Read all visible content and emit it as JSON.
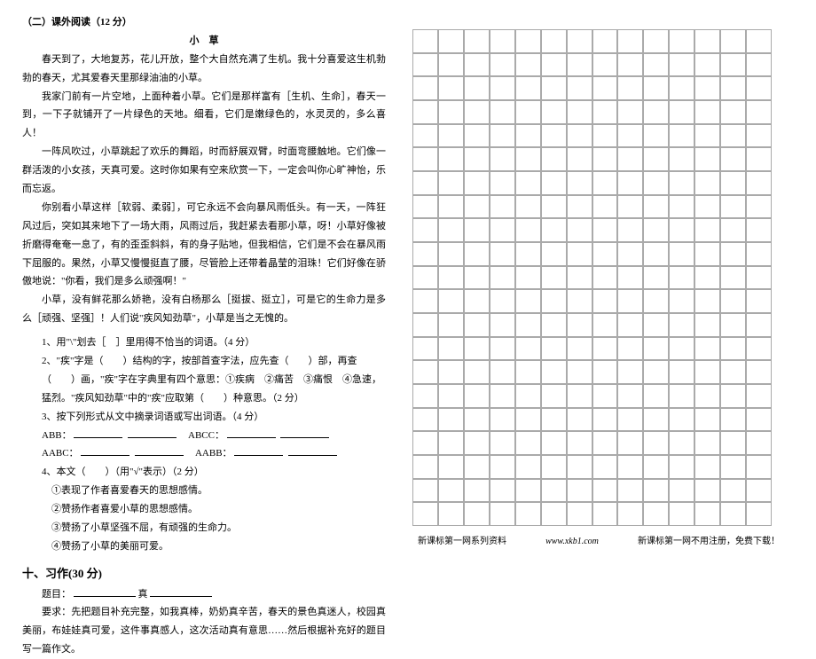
{
  "left": {
    "head1": "（二）课外阅读（12 分）",
    "title": "小　草",
    "p1": "春天到了，大地复苏，花儿开放，整个大自然充满了生机。我十分喜爱这生机勃勃的春天，尤其爱春天里那绿油油的小草。",
    "p2": "我家门前有一片空地，上面种着小草。它们是那样富有［生机、生命］，春天一到，一下子就铺开了一片绿色的天地。细看，它们是嫩绿色的，水灵灵的，多么喜人！",
    "p3": "一阵风吹过，小草跳起了欢乐的舞蹈，时而舒展双臂，时面弯腰触地。它们像一群活泼的小女孩，天真可爱。这时你如果有空来欣赏一下，一定会叫你心旷神怡，乐而忘返。",
    "p4": "你别看小草这样［软弱、柔弱］，可它永远不会向暴风雨低头。有一天，一阵狂风过后，突如其来地下了一场大雨，风雨过后，我赶紧去看那小草，呀！小草好像被折磨得奄奄一息了，有的歪歪斜斜，有的身子贴地，但我相信，它们是不会在暴风雨下屈服的。果然，小草又慢慢挺直了腰，尽管脸上还带着晶莹的泪珠！它们好像在骄傲地说：\"你看，我们是多么顽强啊！\"",
    "p5": "小草，没有鲜花那么娇艳，没有白杨那么［挺拔、挺立］，可是它的生命力是多么［顽强、坚强］！人们说\"疾风知劲草\"，小草是当之无愧的。",
    "q1": "1、用\"\\\"划去［　］里用得不恰当的词语。（4 分）",
    "q2": "2、\"疾\"字是（　　）结构的字，按部首查字法，应先查（　　）部，再查（　　）画，\"疾\"字在字典里有四个意思：①疾病　②痛苦　③痛恨　④急速，猛烈。\"疾风知劲草\"中的\"疾\"应取第（　　）种意思。（2 分）",
    "q3": "3、按下列形式从文中摘录词语或写出词语。（4 分）",
    "q3a_l": "ABB：",
    "q3a_r": "ABCC：",
    "q3b_l": "AABC：",
    "q3b_r": "AABB：",
    "q4": "4、本文（　　）（用\"√\"表示）（2 分）",
    "q4a": "①表现了作者喜爱春天的思想感情。",
    "q4b": "②赞扬作者喜爱小草的思想感情。",
    "q4c": "③赞扬了小草坚强不屈，有顽强的生命力。",
    "q4d": "④赞扬了小草的美丽可爱。",
    "xizuo_head": "十、习作(30 分)",
    "xizuo_title_a": "题目：",
    "xizuo_title_b": "真",
    "xizuo_req": "要求：先把题目补充完整，如我真棒，奶奶真辛苦，春天的景色真迷人，校园真美丽，布娃娃真可爱，这件事真感人，这次活动真有意思……然后根据补充好的题目写一篇作文。"
  },
  "footer": {
    "a": "新课标第一网系列资料",
    "b": "www.xkb1.com",
    "c": "新课标第一网不用注册，免费下载！"
  }
}
